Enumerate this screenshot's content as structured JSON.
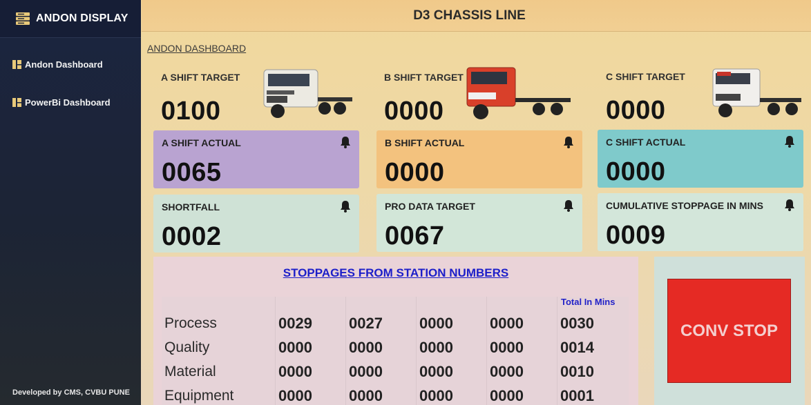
{
  "app": {
    "title": "ANDON DISPLAY"
  },
  "sidebar": {
    "items": [
      {
        "label": "Andon Dashboard"
      },
      {
        "label": "PowerBi Dashboard"
      }
    ],
    "footer": "Developed by CMS, CVBU PUNE"
  },
  "header": {
    "line_title": "D3 CHASSIS LINE"
  },
  "breadcrumb": "ANDON DASHBOARD",
  "targets": [
    {
      "label": "A SHIFT TARGET",
      "value": "0100"
    },
    {
      "label": "B SHIFT TARGET",
      "value": "0000"
    },
    {
      "label": "C SHIFT TARGET",
      "value": "0000"
    }
  ],
  "actuals": [
    {
      "label": "A SHIFT ACTUAL",
      "value": "0065",
      "color": "#b9a3d1"
    },
    {
      "label": "B SHIFT ACTUAL",
      "value": "0000",
      "color": "#f3c27e"
    },
    {
      "label": "C SHIFT ACTUAL",
      "value": "0000",
      "color": "#7fcacb"
    }
  ],
  "metrics": [
    {
      "label": "SHORTFALL",
      "value": "0002",
      "color": "#cfe2d6"
    },
    {
      "label": "PRO DATA TARGET",
      "value": "0067",
      "color": "#d2e6d8"
    },
    {
      "label": "CUMULATIVE STOPPAGE IN MINS",
      "value": "0009",
      "color": "#d3e6da"
    }
  ],
  "icons": {
    "bell": "bell-icon",
    "truck": "truck-icon",
    "nav": "dashboard-icon",
    "logo": "server-icon"
  },
  "stoppages": {
    "title": "STOPPAGES FROM STATION NUMBERS",
    "total_header": "Total In Mins",
    "rows": [
      {
        "label": "Process",
        "values": [
          "0029",
          "0027",
          "0000",
          "0000",
          "0030"
        ]
      },
      {
        "label": "Quality",
        "values": [
          "0000",
          "0000",
          "0000",
          "0000",
          "0014"
        ]
      },
      {
        "label": "Material",
        "values": [
          "0000",
          "0000",
          "0000",
          "0000",
          "0010"
        ]
      },
      {
        "label": "Equipment",
        "values": [
          "0000",
          "0000",
          "0000",
          "0000",
          "0001"
        ]
      }
    ]
  },
  "conv_stop": {
    "label": "CONV STOP",
    "color": "#e52a24"
  }
}
